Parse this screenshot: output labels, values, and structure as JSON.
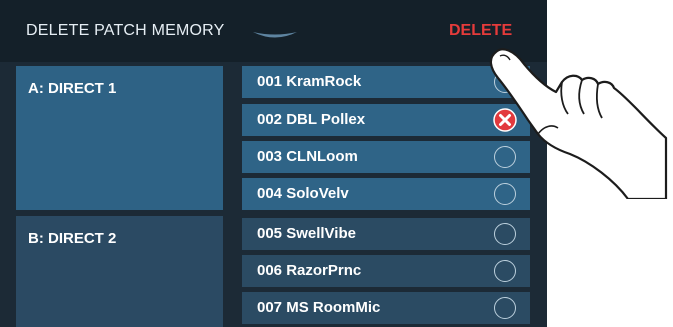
{
  "header": {
    "title": "DELETE PATCH MEMORY",
    "chevron_icon": "chevron-down-icon",
    "delete_label": "DELETE"
  },
  "banks": [
    {
      "label": "A: DIRECT 1"
    },
    {
      "label": "B: DIRECT 2"
    }
  ],
  "patches": [
    {
      "label": "001 KramRock",
      "selected": false
    },
    {
      "label": "002 DBL Pollex",
      "selected": true
    },
    {
      "label": "003 CLNLoom",
      "selected": false
    },
    {
      "label": "004 SoloVelv",
      "selected": false
    },
    {
      "label": "005 SwellVibe",
      "selected": false
    },
    {
      "label": "006 RazorPrnc",
      "selected": false
    },
    {
      "label": "007 MS RoomMic",
      "selected": false
    }
  ],
  "colors": {
    "accent_delete": "#e53b3b",
    "bank_a_bg": "#2e6285",
    "bank_b_bg": "#2b4a63",
    "header_bg": "#142029"
  },
  "icons": {
    "selected_mark": "x-circle-icon",
    "unselected_mark": "radio-circle-icon",
    "pointer": "pointing-hand-icon"
  }
}
